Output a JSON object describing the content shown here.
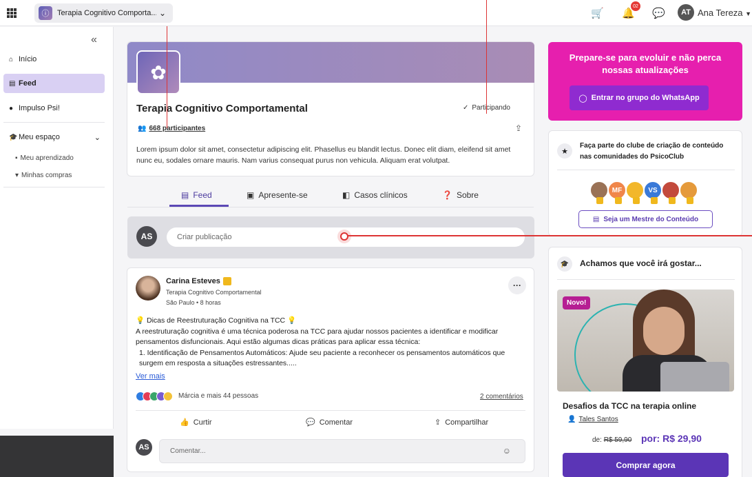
{
  "topbar": {
    "community_name": "Terapia Cognitivo Comporta...",
    "notification_count": "02",
    "user_initials": "AT",
    "user_name": "Ana Tereza"
  },
  "sidebar": {
    "items": [
      {
        "label": "Início",
        "icon": "home-icon"
      },
      {
        "label": "Feed",
        "icon": "feed-icon"
      },
      {
        "label": "Impulso Psi!",
        "icon": "bulb-icon"
      },
      {
        "label": "Meu espaço",
        "icon": "graduation-cap-icon"
      }
    ],
    "subitems": [
      {
        "label": "Meu aprendizado",
        "icon": "book-icon"
      },
      {
        "label": "Minhas compras",
        "icon": "cart-icon"
      }
    ]
  },
  "community": {
    "title": "Terapia Cognitivo Comportamental",
    "participating": "Participando",
    "participants": "668 participantes",
    "description": "Lorem ipsum dolor sit amet, consectetur adipiscing elit. Phasellus eu blandit lectus. Donec elit diam, eleifend sit amet nunc eu, sodales ornare mauris. Nam varius consequat purus non vehicula. Aliquam erat volutpat."
  },
  "tabs": [
    {
      "label": "Feed"
    },
    {
      "label": "Apresente-se"
    },
    {
      "label": "Casos clínicos"
    },
    {
      "label": "Sobre"
    }
  ],
  "composer": {
    "avatar": "AS",
    "placeholder": "Criar publicação"
  },
  "post": {
    "author": "Carina Esteves",
    "community": "Terapia Cognitivo Comportamental",
    "meta": "São Paulo • 8 horas",
    "headline": "💡 Dicas de Reestruturação Cognitiva na TCC 💡",
    "body": "A reestruturação cognitiva é uma técnica poderosa na TCC para ajudar nossos pacientes a identificar e modificar pensamentos disfuncionais. Aqui estão algumas dicas práticas para aplicar essa técnica:",
    "list_item": "1. Identificação de Pensamentos Automáticos: Ajude seu paciente a reconhecer os pensamentos automáticos que surgem em resposta a situações estressantes.....",
    "see_more": "Ver mais",
    "reactions": "Márcia e mais 44 pessoas",
    "comments": "2 comentários",
    "actions": {
      "like": "Curtir",
      "comment": "Comentar",
      "share": "Compartilhar"
    },
    "comment_avatar": "AS",
    "comment_placeholder": "Comentar..."
  },
  "promo": {
    "title": "Prepare-se para evoluir e não perca nossas atualizações",
    "button": "Entrar no grupo do WhatsApp"
  },
  "club": {
    "text": "Faça parte  do clube de criação de conteúdo nas comunidades do  PsicoClub",
    "members": [
      "MF",
      "VS"
    ],
    "button": "Seja um Mestre do Conteúdo"
  },
  "recommend": {
    "header": "Achamos que você irá gostar...",
    "tag": "Novo!",
    "course_title": "Desafios da TCC na terapia online",
    "author": "Tales Santos",
    "old_price_label": "de:",
    "old_price": "R$ 59,90",
    "new_price": "por: R$ 29,90",
    "buy": "Comprar agora"
  },
  "colors": {
    "accent": "#5b35b6",
    "promo": "#e61fae",
    "whatsapp_btn": "#8f2bd0",
    "annotation": "#d33333"
  }
}
